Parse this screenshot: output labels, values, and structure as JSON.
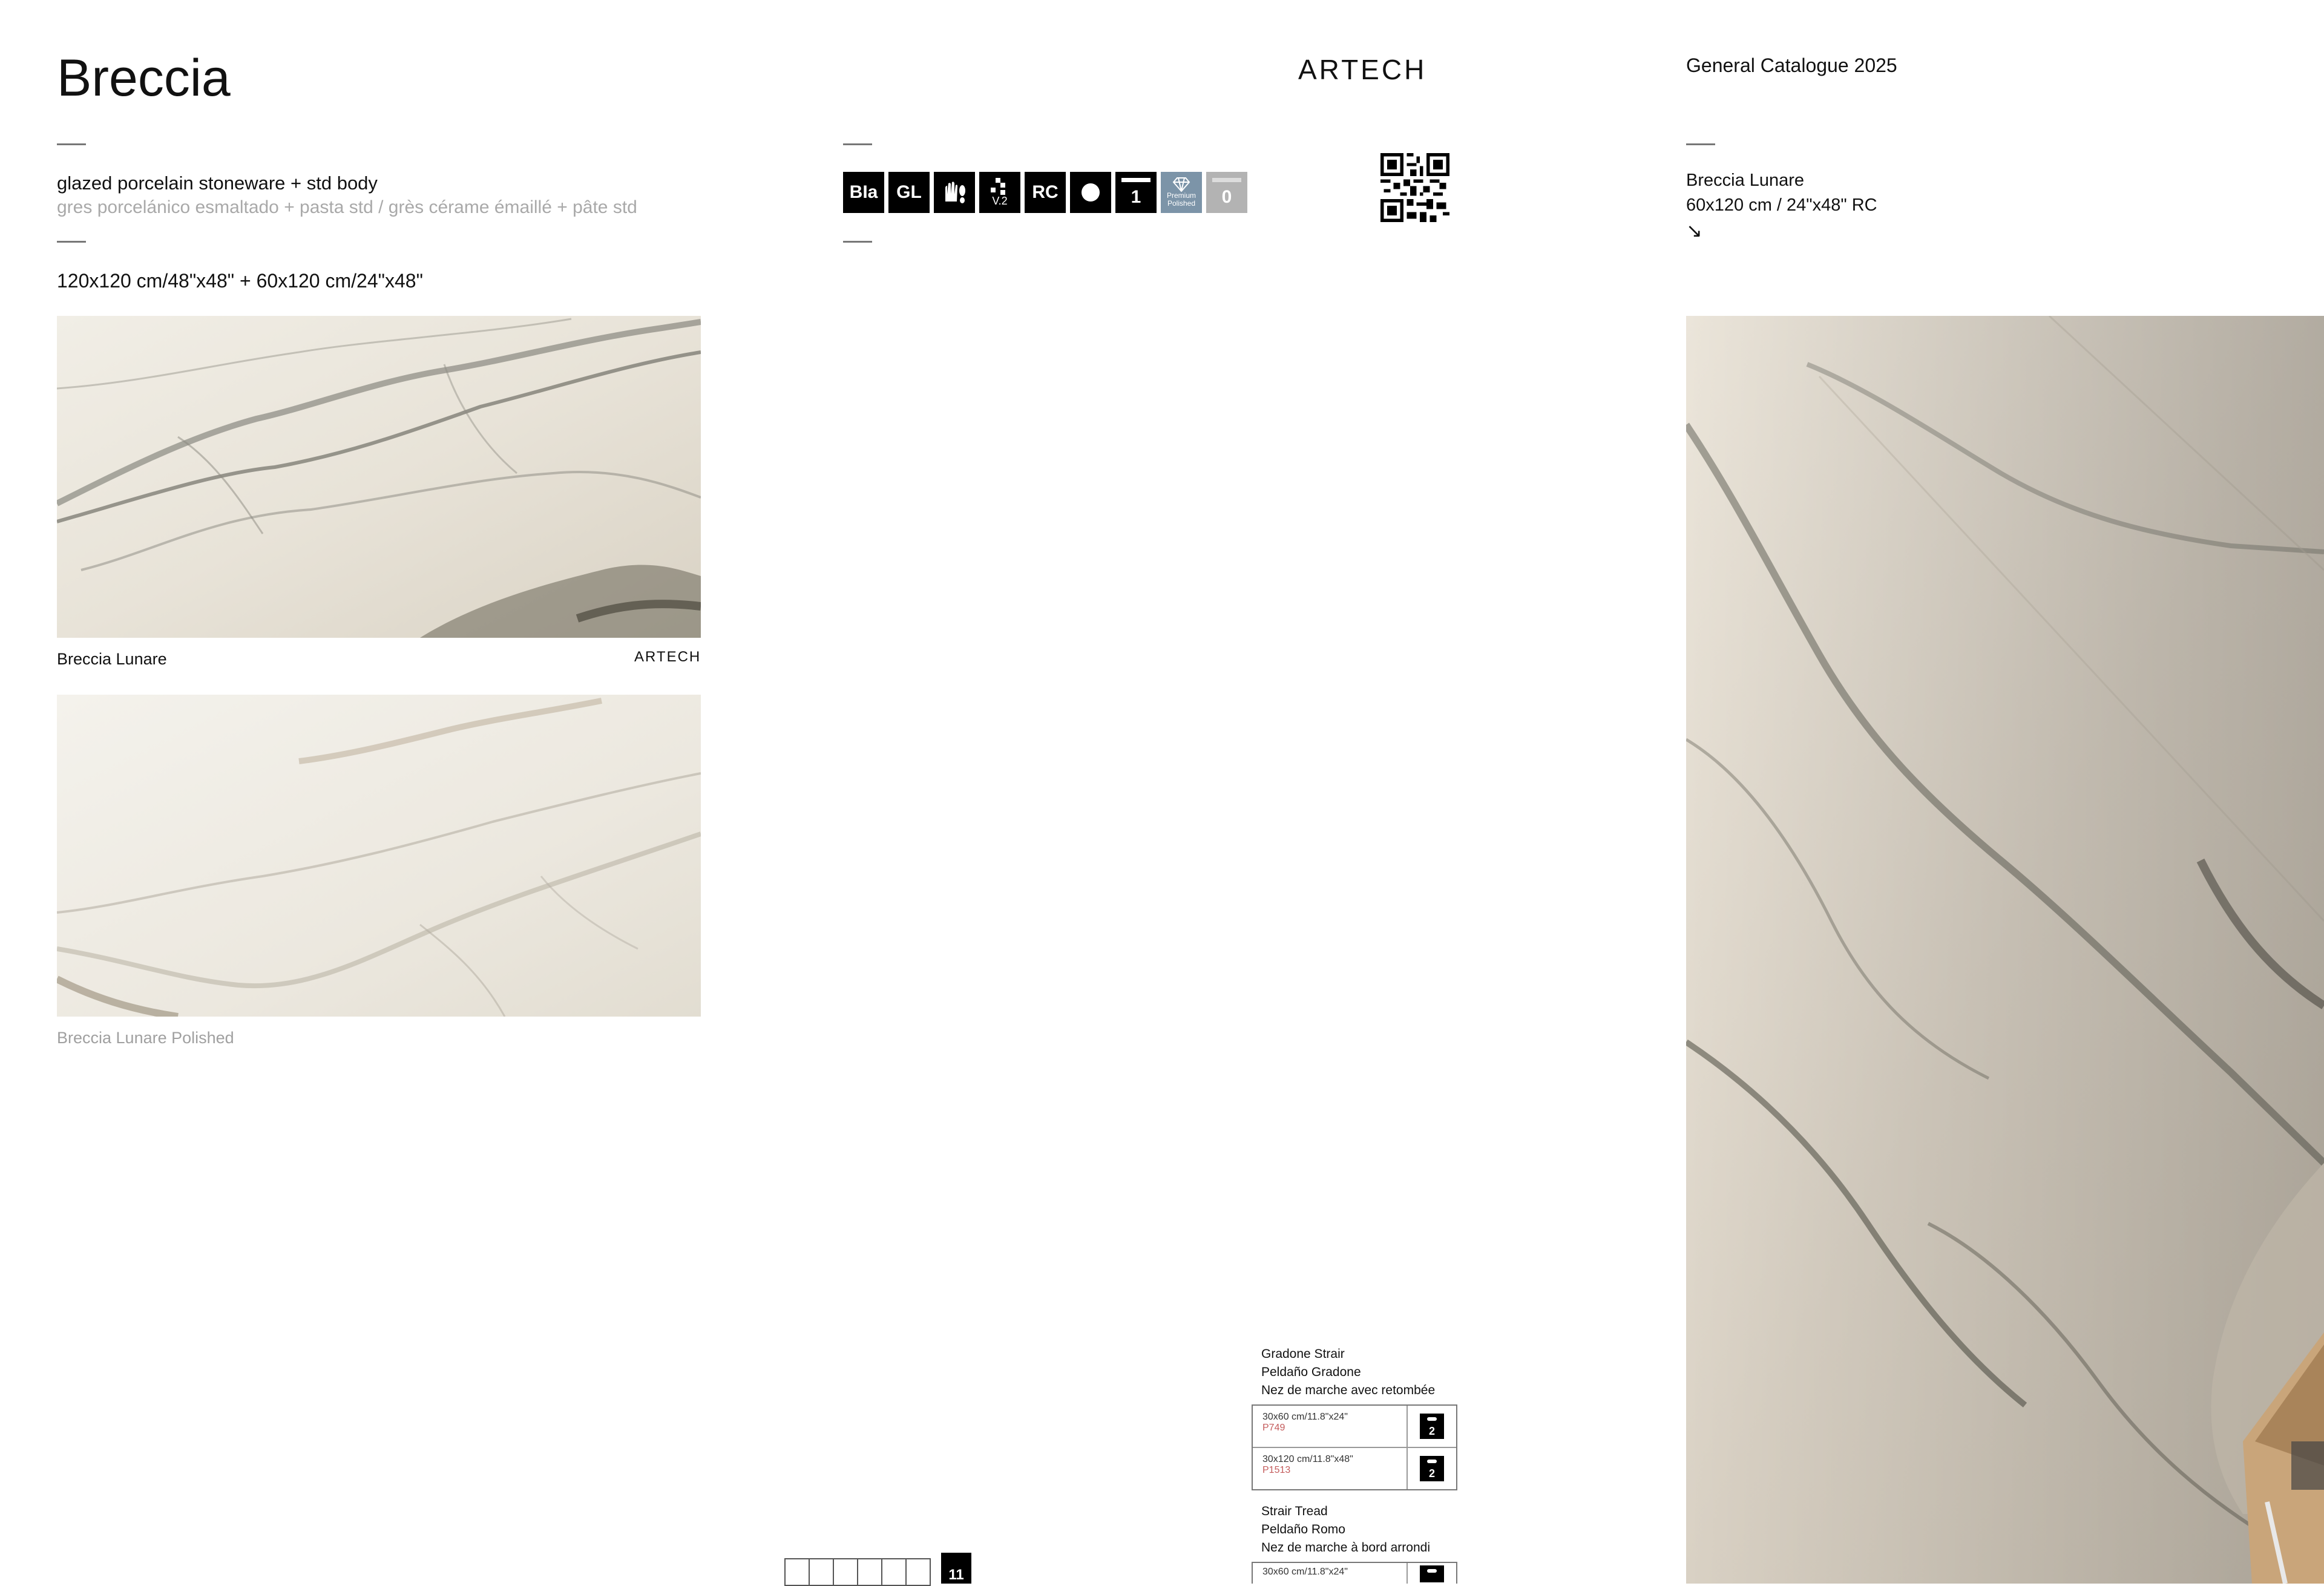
{
  "header": {
    "title": "Breccia",
    "brand": "ARTECH",
    "catalogue": "General Catalogue 2025"
  },
  "description": {
    "main": "glazed porcelain stoneware + std body",
    "sub": "gres porcelánico esmaltado + pasta std / grès cérame émaillé + pâte std",
    "sizes": "120x120 cm/48\"x48\" + 60x120 cm/24\"x48\""
  },
  "tiles": [
    {
      "caption": "Breccia Lunare",
      "brand": "ARTECH"
    },
    {
      "caption": "Breccia Lunare Polished"
    }
  ],
  "icons": [
    {
      "label": "BIa",
      "icon": "bia-icon"
    },
    {
      "label": "GL",
      "icon": "gl-icon"
    },
    {
      "label": "",
      "icon": "hand-foot-icon"
    },
    {
      "label": "V.2",
      "icon": "shade-variation-icon"
    },
    {
      "label": "RC",
      "icon": "rectified-icon"
    },
    {
      "label": "",
      "icon": "circle-icon"
    },
    {
      "label": "1",
      "icon": "thickness-icon"
    },
    {
      "label": "Premium Polished",
      "icon": "diamond-icon"
    },
    {
      "label": "0",
      "icon": "thickness-icon"
    }
  ],
  "right_column": {
    "name": "Breccia Lunare",
    "size": "60x120 cm / 24\"x48\" RC",
    "arrow": "↘"
  },
  "trims": [
    {
      "labels": [
        "Gradone Strair",
        "Peldaño Gradone",
        "Nez de marche avec retombée"
      ],
      "rows": [
        {
          "size": "30x60 cm/11.8\"x24\"",
          "code": "P749",
          "badge": "2"
        },
        {
          "size": "30x120 cm/11.8\"x48\"",
          "code": "P1513",
          "badge": "2"
        }
      ]
    },
    {
      "labels": [
        "Strair Tread",
        "Peldaño Romo",
        "Nez de marche à bord arrondi"
      ],
      "rows": [
        {
          "size": "30x60 cm/11.8\"x24\"",
          "code": "",
          "badge": ""
        }
      ]
    }
  ],
  "pack_badge": "11",
  "colors": {
    "accent_blue": "#7c94a8",
    "trim_code": "#c45c5c",
    "sub_grey": "#a9a9a9"
  }
}
